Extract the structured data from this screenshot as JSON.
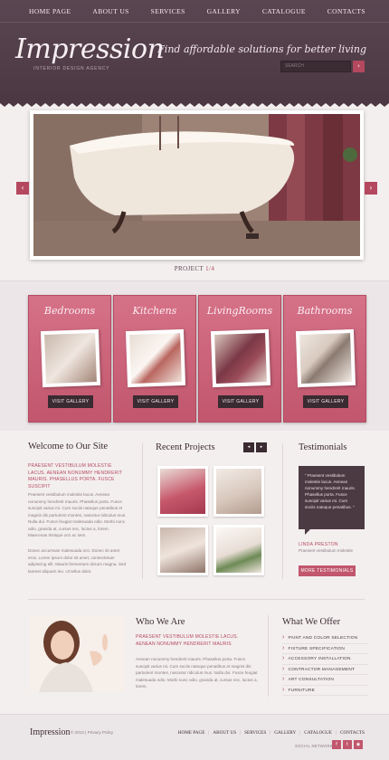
{
  "nav": {
    "items": [
      "HOME PAGE",
      "ABOUT US",
      "SERVICES",
      "GALLERY",
      "CATALOGUE",
      "CONTACTS"
    ]
  },
  "brand": {
    "logo": "Impression",
    "tagline": "INTERIOR DESIGN AGENCY",
    "slogan": "Find affordable solutions for better living"
  },
  "search": {
    "placeholder": "SEARCH",
    "button_icon": "arrow-right-icon"
  },
  "slider": {
    "label": "PROJECT",
    "current": "1/4",
    "prev_icon": "chevron-left-icon",
    "next_icon": "chevron-right-icon"
  },
  "categories": [
    {
      "title": "Bedrooms",
      "button": "VISIT GALLERY"
    },
    {
      "title": "Kitchens",
      "button": "VISIT GALLERY"
    },
    {
      "title": "LivingRooms",
      "button": "VISIT GALLERY"
    },
    {
      "title": "Bathrooms",
      "button": "VISIT GALLERY"
    }
  ],
  "welcome": {
    "title": "Welcome to Our Site",
    "lead": "PRAESENT VESTIBULUM MOLESTIE LACUS. AENEAN NONUMMY HENDRERIT MAURIS. PHASELLUS PORTA. FUSCE SUSCIPIT",
    "para1": "Praesent vestibulum molestie lacus. Aenean nonummy hendrerit mauris. Phasellus porta. Fusce suscipit varius mi. Cum sociis natoque penatibus et magnis dis parturient montes, nascetur ridiculus mus. Nulla dui. Fusce feugiat malesuada odio. Morbi nunc odio, gravida at, cursus nec, luctus a, lorem. Maecenas tristique orci ac sem.",
    "para2": "Donec accumsan malesuada orci. Donec sit amet eros. Lorem ipsum dolor sit amet, consectetuer adipiscing elit. Mauris fermentum dictum magna. Sed laoreet aliquam leo. Ut tellus dolor."
  },
  "recent": {
    "title": "Recent Projects",
    "prev_icon": "chevron-left-icon",
    "next_icon": "chevron-right-icon"
  },
  "testimonials": {
    "title": "Testimonials",
    "quote": "“ Praesent vestibulum molestie lacus. Aenean nonummy hendrerit mauris. Phasellus porta. Fusce suscipit varius mi. Cum sociis natoque penatibus. ”",
    "name": "LINDA PRESTON",
    "role": "Praesent vestibulum molestie",
    "button": "MORE TESTIMONIALS"
  },
  "who": {
    "title": "Who We Are",
    "lead": "PRAESENT VESTIBULUM MOLESTIE LACUS. AENEAN NONUMMY HENDRERIT MAURIS",
    "body": "Aenean nonummy hendrerit mauris. Phasellus porta. Fusce suscipit varius mi. Cum sociis natoque penatibus et magnis dis parturient montes, nascetur ridiculus mus. Nulla dui. Fusce feugiat malesuada odio. Morbi nunc odio, gravida at, cursus nec, luctus a, lorem."
  },
  "offer": {
    "title": "What We Offer",
    "items": [
      "PAINT AND COLOR SELECTION",
      "FIXTURE SPECIFICATION",
      "ACCESSORY INSTALLATION",
      "CONTRACTOR MANAGEMENT",
      "ART CONSULTATION",
      "FURNITURE"
    ]
  },
  "footer": {
    "logo": "Impression",
    "copy": "© 2012  |  Privacy Policy",
    "nav": [
      "HOME PAGE",
      "ABOUT US",
      "SERVICES",
      "GALLERY",
      "CATALOGUE",
      "CONTACTS"
    ],
    "social_label": "SOCIAL NETWORK",
    "social": [
      "facebook-icon",
      "twitter-icon",
      "feed-icon"
    ]
  },
  "colors": {
    "header": "#4b3842",
    "accent": "#c1566d",
    "dark_button": "#3a2a31"
  }
}
